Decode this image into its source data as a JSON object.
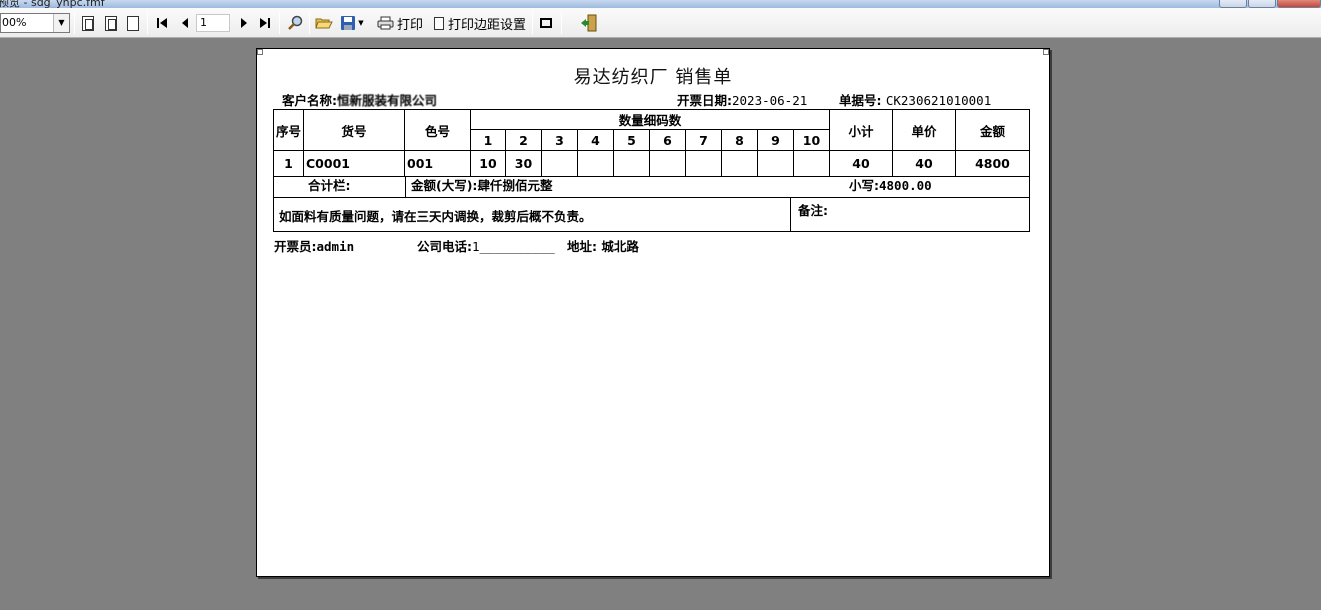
{
  "window": {
    "title": "预览 - sdg_yhpc.fmf"
  },
  "toolbar": {
    "zoom_value": "00%",
    "page_number": "1",
    "print_label": "打印",
    "print_margin_label": "打印边距设置"
  },
  "document": {
    "title": "易达纺织厂  销售单",
    "customer_label": "客户名称:",
    "customer_value": "恒新服装有限公司",
    "invoice_date_label": "开票日期:",
    "invoice_date_value": "2023-06-21",
    "order_no_label": "单据号:",
    "order_no_value": "CK230621010001",
    "table": {
      "headers": {
        "seq": "序号",
        "item_no": "货号",
        "color_no": "色号",
        "qty_group": "数量细码数",
        "subtotal": "小计",
        "unit_price": "单价",
        "amount": "金额"
      },
      "size_columns": [
        "1",
        "2",
        "3",
        "4",
        "5",
        "6",
        "7",
        "8",
        "9",
        "10"
      ],
      "rows": [
        {
          "seq": "1",
          "item_no": "C0001",
          "color_no": "001",
          "sizes": [
            "10",
            "30",
            "",
            "",
            "",
            "",
            "",
            "",
            "",
            ""
          ],
          "subtotal": "40",
          "unit_price": "40",
          "amount": "4800"
        }
      ]
    },
    "summary": {
      "total_label": "合计栏:",
      "amount_upper_label": "金额(大写):",
      "amount_upper_value": "肆仟捌佰元整",
      "amount_lower_label": "小写:",
      "amount_lower_value": "4800.00"
    },
    "notice": "如面料有质量问题，请在三天内调换，裁剪后概不负责。",
    "remark_label": "备注:",
    "footer": {
      "issuer_label": "开票员:",
      "issuer_value": "admin",
      "phone_label": "公司电话:",
      "phone_value": "1__________",
      "address_label": "地址:",
      "address_value": "城北路"
    }
  }
}
